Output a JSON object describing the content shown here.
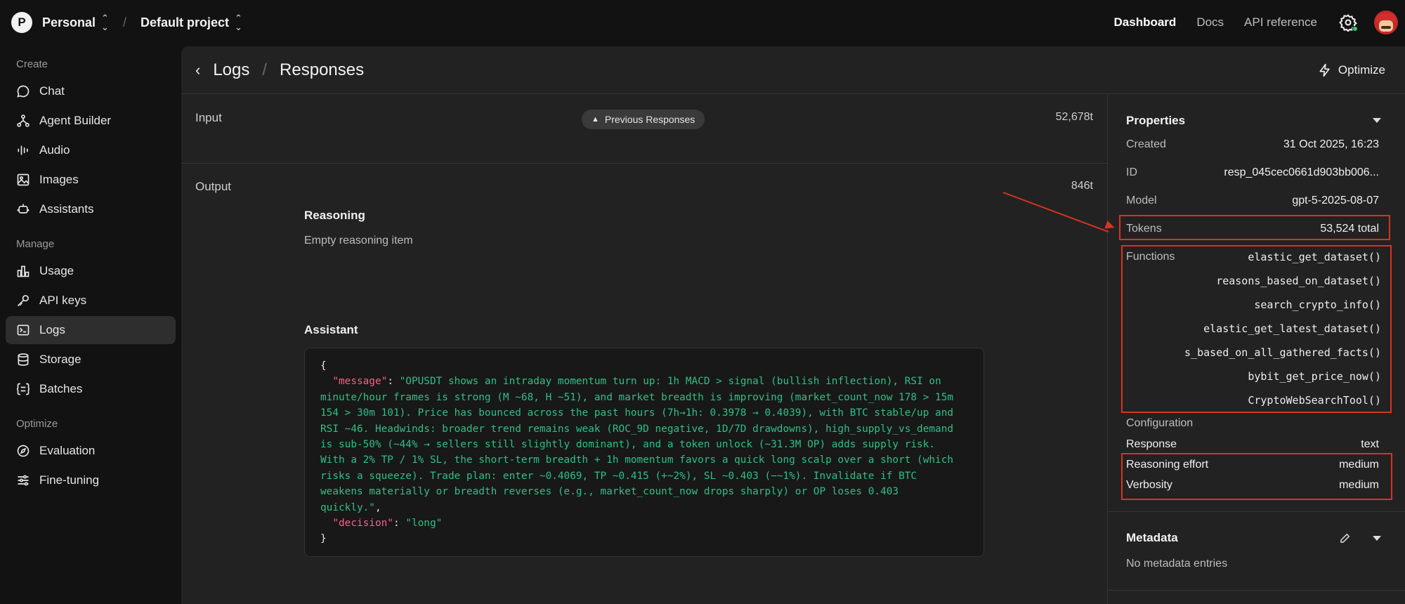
{
  "topbar": {
    "org_initial": "P",
    "org_name": "Personal",
    "project_name": "Default project",
    "nav": [
      "Dashboard",
      "Docs",
      "API reference"
    ],
    "active_nav": "Dashboard"
  },
  "sidebar": {
    "sections": [
      {
        "title": "Create",
        "items": [
          {
            "label": "Chat",
            "icon": "chat-icon"
          },
          {
            "label": "Agent Builder",
            "icon": "agent-builder-icon"
          },
          {
            "label": "Audio",
            "icon": "audio-icon"
          },
          {
            "label": "Images",
            "icon": "images-icon"
          },
          {
            "label": "Assistants",
            "icon": "assistants-icon"
          }
        ]
      },
      {
        "title": "Manage",
        "items": [
          {
            "label": "Usage",
            "icon": "usage-icon"
          },
          {
            "label": "API keys",
            "icon": "key-icon"
          },
          {
            "label": "Logs",
            "icon": "logs-icon",
            "active": true
          },
          {
            "label": "Storage",
            "icon": "storage-icon"
          },
          {
            "label": "Batches",
            "icon": "batches-icon"
          }
        ]
      },
      {
        "title": "Optimize",
        "items": [
          {
            "label": "Evaluation",
            "icon": "evaluation-icon"
          },
          {
            "label": "Fine-tuning",
            "icon": "fine-tuning-icon"
          }
        ]
      }
    ]
  },
  "header": {
    "parent": "Logs",
    "current": "Responses",
    "optimize_label": "Optimize"
  },
  "input": {
    "label": "Input",
    "prev_button": "Previous Responses",
    "tokens": "52,678t"
  },
  "output": {
    "label": "Output",
    "tokens": "846t",
    "reasoning_title": "Reasoning",
    "reasoning_text": "Empty reasoning item",
    "assistant_title": "Assistant",
    "json": {
      "message_key": "\"message\"",
      "message_lines": [
        "\"OPUSDT shows an intraday momentum turn up: 1h MACD > signal (bullish inflection), RSI on",
        "minute/hour frames is strong (M ~68, H ~51), and market breadth is improving (market_count_now 178 > 15m",
        "154 > 30m 101). Price has bounced across the past hours (7h→1h: 0.3978 → 0.4039), with BTC stable/up and",
        "RSI ~46. Headwinds: broader trend remains weak (ROC_9D negative, 1D/7D drawdowns), high_supply_vs_demand",
        "is sub-50% (~44% → sellers still slightly dominant), and a token unlock (~31.3M OP) adds supply risk.",
        "With a 2% TP / 1% SL, the short-term breadth + 1h momentum favors a quick long scalp over a short (which",
        "risks a squeeze). Trade plan: enter ~0.4069, TP ~0.415 (+~2%), SL ~0.403 (−~1%). Invalidate if BTC",
        "weakens materially or breadth reverses (e.g., market_count_now drops sharply) or OP loses 0.403",
        "quickly.\""
      ],
      "decision_key": "\"decision\"",
      "decision_value": "\"long\""
    }
  },
  "properties": {
    "title": "Properties",
    "created_label": "Created",
    "created_value": "31 Oct 2025, 16:23",
    "id_label": "ID",
    "id_value": "resp_045cec0661d903bb006...",
    "model_label": "Model",
    "model_value": "gpt-5-2025-08-07",
    "tokens_label": "Tokens",
    "tokens_value": "53,524 total",
    "functions_label": "Functions",
    "functions": [
      "elastic_get_dataset()",
      "reasons_based_on_dataset()",
      "search_crypto_info()",
      "elastic_get_latest_dataset()",
      "s_based_on_all_gathered_facts()",
      "bybit_get_price_now()",
      "CryptoWebSearchTool()"
    ],
    "configuration_label": "Configuration",
    "response_label": "Response",
    "response_value": "text",
    "reasoning_effort_label": "Reasoning effort",
    "reasoning_effort_value": "medium",
    "verbosity_label": "Verbosity",
    "verbosity_value": "medium"
  },
  "metadata": {
    "title": "Metadata",
    "empty_text": "No metadata entries"
  },
  "colors": {
    "annotation": "#d9331f",
    "json_key": "#ff5e8a",
    "json_string": "#2fbf8a"
  }
}
